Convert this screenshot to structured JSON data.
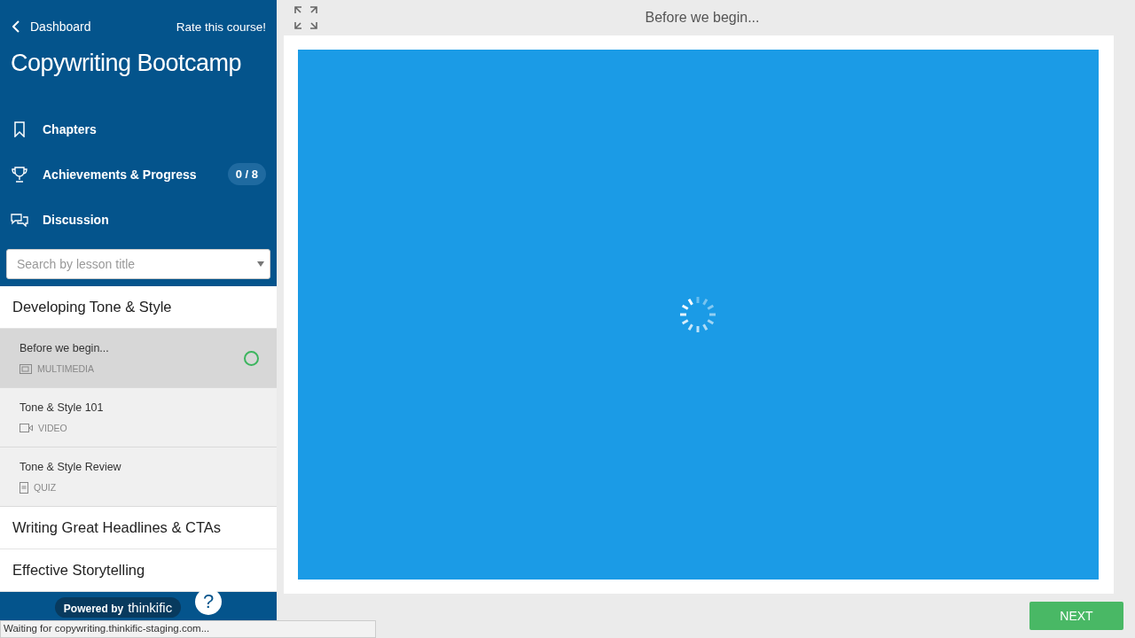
{
  "sidebar": {
    "back_link": "Dashboard",
    "rate_link": "Rate this course!",
    "course_title": "Copywriting Bootcamp",
    "nav": [
      {
        "kind": "chapters",
        "label": "Chapters"
      },
      {
        "kind": "achievements",
        "label": "Achievements & Progress",
        "badge": "0 / 8"
      },
      {
        "kind": "discussion",
        "label": "Discussion"
      }
    ],
    "search": {
      "placeholder": "Search by lesson title"
    },
    "chapters": [
      {
        "title": "Developing Tone & Style",
        "lessons": [
          {
            "title": "Before we begin...",
            "kind": "multimedia",
            "type_label": "MULTIMEDIA",
            "selected": true,
            "started": true
          },
          {
            "title": "Tone & Style 101",
            "kind": "video",
            "type_label": "VIDEO",
            "selected": false,
            "started": false
          },
          {
            "title": "Tone & Style Review",
            "kind": "quiz",
            "type_label": "QUIZ",
            "selected": false,
            "started": false
          }
        ]
      },
      {
        "title": "Writing Great Headlines & CTAs"
      },
      {
        "title": "Effective Storytelling"
      }
    ],
    "footer": {
      "powered_by": "Powered by",
      "brand": "thinkific",
      "help": "?"
    }
  },
  "content": {
    "title": "Before we begin...",
    "loading": true
  },
  "next_button": "NEXT",
  "status_bar": "Waiting for copywriting.thinkific-staging.com..."
}
